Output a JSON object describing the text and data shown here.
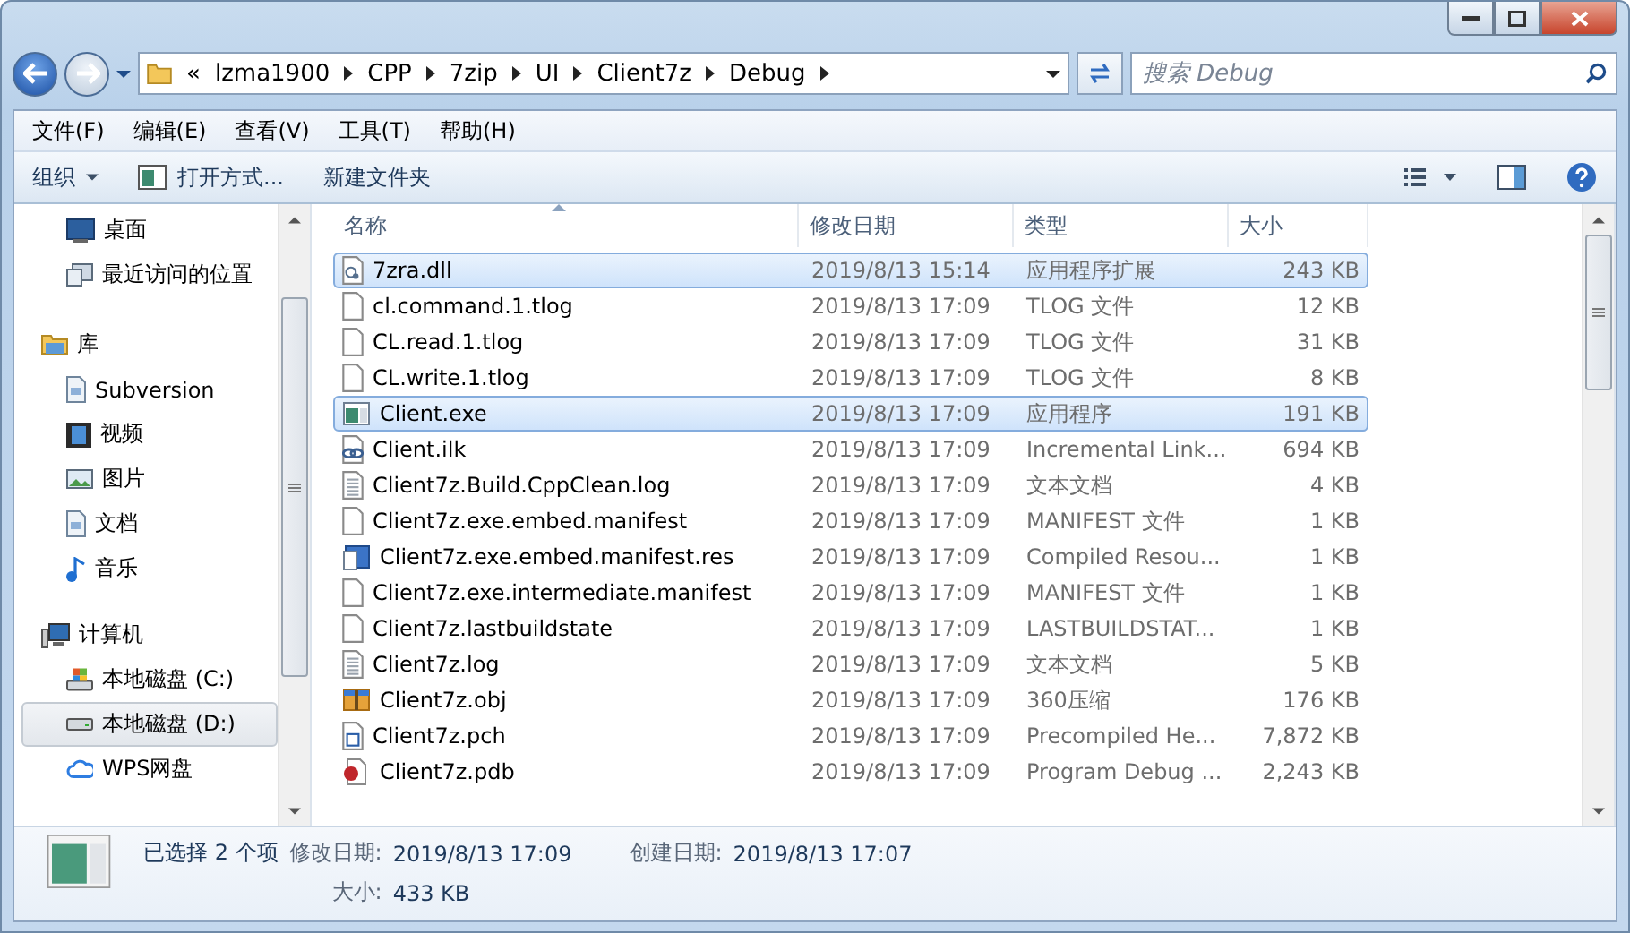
{
  "address": {
    "overflow": "«",
    "crumbs": [
      "lzma1900",
      "CPP",
      "7zip",
      "UI",
      "Client7z",
      "Debug"
    ]
  },
  "search": {
    "placeholder": "搜索 Debug"
  },
  "menu": [
    "文件(F)",
    "编辑(E)",
    "查看(V)",
    "工具(T)",
    "帮助(H)"
  ],
  "toolbar": [
    {
      "label": "组织",
      "kind": "dropdown"
    },
    {
      "label": "打开方式...",
      "kind": "icon"
    },
    {
      "label": "新建文件夹",
      "kind": "plain"
    }
  ],
  "sidebar": {
    "items": [
      {
        "label": "桌面",
        "kind": "desktop",
        "selected": false
      },
      {
        "label": "最近访问的位置",
        "kind": "recent",
        "selected": false
      },
      {
        "label": "库",
        "kind": "library",
        "selected": false,
        "children": [
          {
            "label": "Subversion",
            "kind": "doc",
            "selected": false
          },
          {
            "label": "视频",
            "kind": "video",
            "selected": false
          },
          {
            "label": "图片",
            "kind": "picture",
            "selected": false
          },
          {
            "label": "文档",
            "kind": "doc",
            "selected": false
          },
          {
            "label": "音乐",
            "kind": "music",
            "selected": false
          }
        ]
      },
      {
        "label": "计算机",
        "kind": "computer",
        "selected": false,
        "children": [
          {
            "label": "本地磁盘 (C:)",
            "kind": "sysdrive",
            "selected": false
          },
          {
            "label": "本地磁盘 (D:)",
            "kind": "drive",
            "selected": true
          },
          {
            "label": "WPS网盘",
            "kind": "cloud",
            "selected": false
          }
        ]
      }
    ]
  },
  "table": {
    "columns": [
      "名称",
      "修改日期",
      "类型",
      "大小"
    ],
    "rows": [
      {
        "name": "7zra.dll",
        "date": "2019/8/13 15:14",
        "type": "应用程序扩展",
        "size": "243 KB",
        "kind": "dll",
        "selected": true
      },
      {
        "name": "cl.command.1.tlog",
        "date": "2019/8/13 17:09",
        "type": "TLOG 文件",
        "size": "12 KB",
        "kind": "file",
        "selected": false
      },
      {
        "name": "CL.read.1.tlog",
        "date": "2019/8/13 17:09",
        "type": "TLOG 文件",
        "size": "31 KB",
        "kind": "file",
        "selected": false
      },
      {
        "name": "CL.write.1.tlog",
        "date": "2019/8/13 17:09",
        "type": "TLOG 文件",
        "size": "8 KB",
        "kind": "file",
        "selected": false
      },
      {
        "name": "Client.exe",
        "date": "2019/8/13 17:09",
        "type": "应用程序",
        "size": "191 KB",
        "kind": "exe",
        "selected": true
      },
      {
        "name": "Client.ilk",
        "date": "2019/8/13 17:09",
        "type": "Incremental Link...",
        "size": "694 KB",
        "kind": "link",
        "selected": false
      },
      {
        "name": "Client7z.Build.CppClean.log",
        "date": "2019/8/13 17:09",
        "type": "文本文档",
        "size": "4 KB",
        "kind": "text",
        "selected": false
      },
      {
        "name": "Client7z.exe.embed.manifest",
        "date": "2019/8/13 17:09",
        "type": "MANIFEST 文件",
        "size": "1 KB",
        "kind": "file",
        "selected": false
      },
      {
        "name": "Client7z.exe.embed.manifest.res",
        "date": "2019/8/13 17:09",
        "type": "Compiled Resou...",
        "size": "1 KB",
        "kind": "res",
        "selected": false
      },
      {
        "name": "Client7z.exe.intermediate.manifest",
        "date": "2019/8/13 17:09",
        "type": "MANIFEST 文件",
        "size": "1 KB",
        "kind": "file",
        "selected": false
      },
      {
        "name": "Client7z.lastbuildstate",
        "date": "2019/8/13 17:09",
        "type": "LASTBUILDSTAT...",
        "size": "1 KB",
        "kind": "file",
        "selected": false
      },
      {
        "name": "Client7z.log",
        "date": "2019/8/13 17:09",
        "type": "文本文档",
        "size": "5 KB",
        "kind": "text",
        "selected": false
      },
      {
        "name": "Client7z.obj",
        "date": "2019/8/13 17:09",
        "type": "360压缩",
        "size": "176 KB",
        "kind": "archive",
        "selected": false
      },
      {
        "name": "Client7z.pch",
        "date": "2019/8/13 17:09",
        "type": "Precompiled He...",
        "size": "7,872 KB",
        "kind": "pch",
        "selected": false
      },
      {
        "name": "Client7z.pdb",
        "date": "2019/8/13 17:09",
        "type": "Program Debug ...",
        "size": "2,243 KB",
        "kind": "pdb",
        "selected": false
      }
    ]
  },
  "details": {
    "summary": "已选择 2 个项",
    "fields": [
      {
        "label": "修改日期:",
        "value": "2019/8/13 17:09"
      },
      {
        "label": "创建日期:",
        "value": "2019/8/13 17:07"
      },
      {
        "label": "大小:",
        "value": "433 KB"
      }
    ]
  }
}
